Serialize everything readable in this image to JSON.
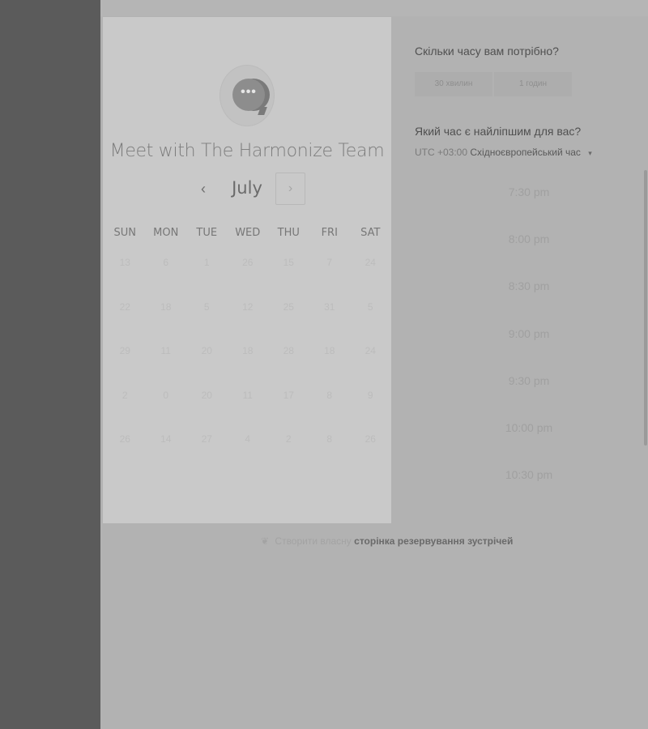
{
  "calendar": {
    "team_name": "Meet with The Harmonize Team",
    "avatar_glyph": "•••",
    "month": "July",
    "prev_symbol": "‹",
    "next_symbol": "›",
    "weekdays": [
      "SUN",
      "MON",
      "TUE",
      "WED",
      "THU",
      "FRI",
      "SAT"
    ],
    "days": [
      [
        "13",
        "6",
        "1",
        "26",
        "15",
        "7",
        "24"
      ],
      [
        "22",
        "18",
        "5",
        "12",
        "25",
        "31",
        "5"
      ],
      [
        "29",
        "11",
        "20",
        "18",
        "28",
        "18",
        "24"
      ],
      [
        "2",
        "0",
        "20",
        "11",
        "17",
        "8",
        "9"
      ],
      [
        "26",
        "14",
        "27",
        "4",
        "2",
        "8",
        "26"
      ]
    ]
  },
  "booking": {
    "duration_heading": "Скільки часу вам потрібно?",
    "durations": [
      "30 хвилин",
      "1 годин"
    ],
    "time_heading": "Який час є найліпшим для вас?",
    "timezone_offset": "UTC +03:00",
    "timezone_name": "Східноєвропейський час",
    "timezone_caret": "▾",
    "slots": [
      "7:30 pm",
      "8:00 pm",
      "8:30 pm",
      "9:00 pm",
      "9:30 pm",
      "10:00 pm",
      "10:30 pm"
    ]
  },
  "footer": {
    "icon": "leaf-icon",
    "prefix": "Створити власну",
    "link": "сторінка резервування зустрічей"
  }
}
